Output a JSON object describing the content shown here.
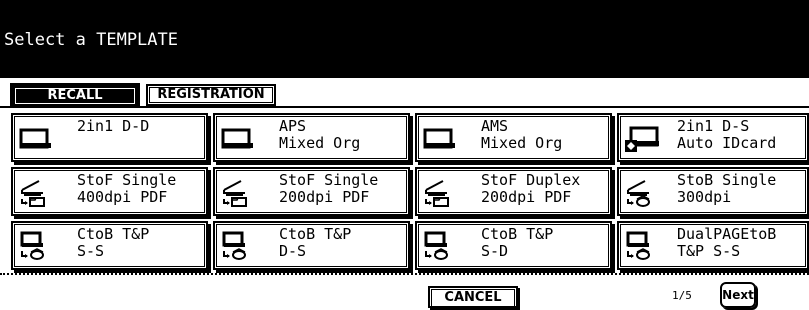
{
  "header": {
    "title": "Select a TEMPLATE"
  },
  "tabs": [
    {
      "label": "RECALL",
      "active": true
    },
    {
      "label": "REGISTRATION",
      "active": false
    }
  ],
  "templates": [
    {
      "line1": "2in1 D-D",
      "line2": "",
      "icon": "copy-icon"
    },
    {
      "line1": "APS",
      "line2": "Mixed Org",
      "icon": "copy-icon"
    },
    {
      "line1": "AMS",
      "line2": "Mixed Org",
      "icon": "copy-icon"
    },
    {
      "line1": "2in1 D-S",
      "line2": "Auto IDcard",
      "icon": "copy-icon"
    },
    {
      "line1": "StoF Single",
      "line2": "400dpi PDF",
      "icon": "scan-to-folder-icon"
    },
    {
      "line1": "StoF Single",
      "line2": "200dpi PDF",
      "icon": "scan-to-folder-icon"
    },
    {
      "line1": "StoF Duplex",
      "line2": "200dpi PDF",
      "icon": "scan-to-folder-icon"
    },
    {
      "line1": "StoB Single",
      "line2": "300dpi",
      "icon": "scan-to-box-icon"
    },
    {
      "line1": "CtoB T&P",
      "line2": "S-S",
      "icon": "copy-to-box-icon"
    },
    {
      "line1": "CtoB T&P",
      "line2": "D-S",
      "icon": "copy-to-box-icon"
    },
    {
      "line1": "CtoB T&P",
      "line2": "S-D",
      "icon": "copy-to-box-icon"
    },
    {
      "line1": "DualPAGEtoB",
      "line2": "T&P S-S",
      "icon": "copy-to-box-icon"
    }
  ],
  "footer": {
    "cancel_label": "CANCEL",
    "page_indicator": "1/5",
    "next_label": "Next"
  }
}
